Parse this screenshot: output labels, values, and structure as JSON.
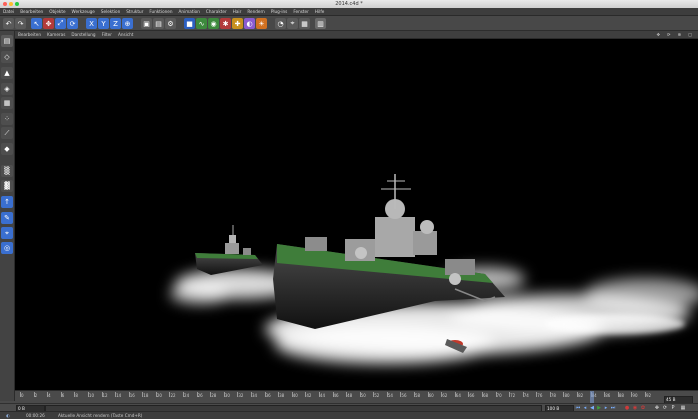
{
  "window": {
    "title": "2014.c4d *"
  },
  "menubar": [
    "Datei",
    "Bearbeiten",
    "Objekte",
    "Werkzeuge",
    "Selektion",
    "Struktur",
    "Funktionen",
    "Animation",
    "Charakter",
    "Hair",
    "Rendern",
    "Plug-ins",
    "Fenster",
    "Hilfe"
  ],
  "viewport_menu": [
    "Bearbeiten",
    "Kameras",
    "Darstellung",
    "Filter",
    "Ansicht"
  ],
  "timeline": {
    "ticks": [
      "0",
      "2",
      "4",
      "6",
      "8",
      "10",
      "12",
      "14",
      "16",
      "18",
      "20",
      "22",
      "24",
      "26",
      "28",
      "30",
      "32",
      "34",
      "36",
      "38",
      "40",
      "42",
      "44",
      "46",
      "48",
      "50",
      "52",
      "54",
      "56",
      "58",
      "60",
      "62",
      "64",
      "66",
      "68",
      "70",
      "72",
      "74",
      "76",
      "78",
      "80",
      "82",
      "84",
      "86",
      "88",
      "90",
      "92"
    ],
    "current_frame_label": "45 B"
  },
  "transport": {
    "start_field": "0 B",
    "end_field": "100 B",
    "playhead_field": "0 B"
  },
  "status": {
    "time": "00:00:26",
    "message": "Aktuelle Ansicht rendern (Taste Cmd+R)"
  },
  "colors": {
    "menubar_bg": "#3d3d3d",
    "viewport_bg": "#000000",
    "accent_blue": "#3a6fd0",
    "ship_hull": "#2a2a2a",
    "ship_deck": "#3f7d3a",
    "spray": "#ffffff"
  }
}
